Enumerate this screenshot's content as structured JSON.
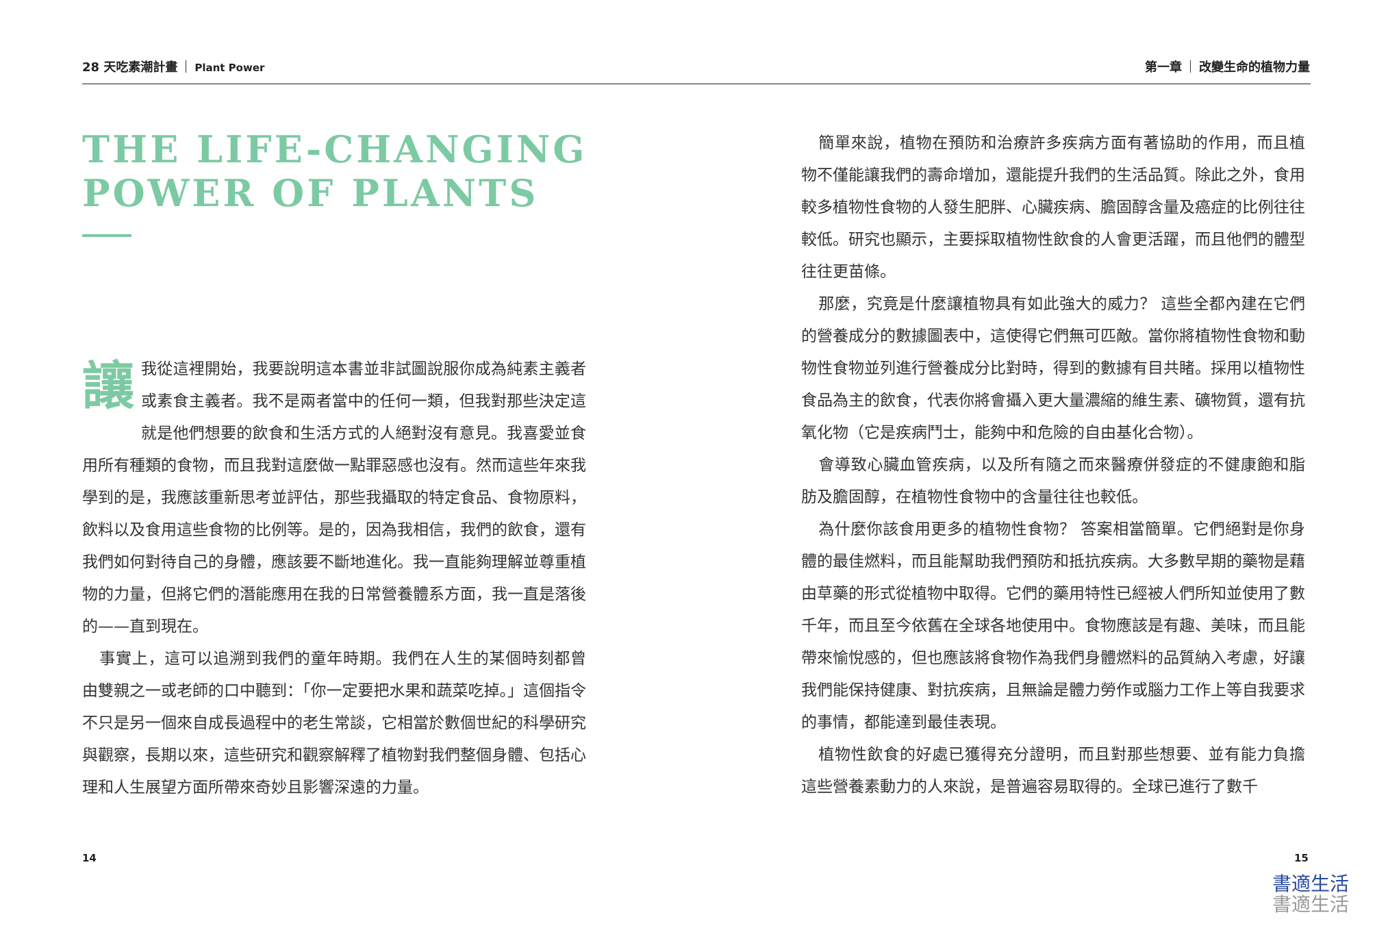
{
  "header": {
    "left_title": "28 天吃素潮計畫",
    "left_subtitle": "Plant Power",
    "right_chapter": "第一章",
    "right_title": "改變生命的植物力量"
  },
  "title": {
    "line1": "THE LIFE-CHANGING",
    "line2": "POWER OF PLANTS"
  },
  "left_column": {
    "dropcap": "讓",
    "p1": "我從這裡開始，我要說明這本書並非試圖說服你成為純素主義者或素食主義者。我不是兩者當中的任何一類，但我對那些決定這就是他們想要的飲食和生活方式的人絕對沒有意見。我喜愛並食用所有種類的食物，而且我對這麼做一點罪惡感也沒有。然而這些年來我學到的是，我應該重新思考並評估，那些我攝取的特定食品、食物原料，飲料以及食用這些食物的比例等。是的，因為我相信，我們的飲食，還有我們如何對待自己的身體，應該要不斷地進化。我一直能夠理解並尊重植物的力量，但將它們的潛能應用在我的日常營養體系方面，我一直是落後的——直到現在。",
    "p2": "事實上，這可以追溯到我們的童年時期。我們在人生的某個時刻都曾由雙親之一或老師的口中聽到：「你一定要把水果和蔬菜吃掉。」這個指令不只是另一個來自成長過程中的老生常談，它相當於數個世紀的科學研究與觀察，長期以來，這些研究和觀察解釋了植物對我們整個身體、包括心理和人生展望方面所帶來奇妙且影響深遠的力量。"
  },
  "right_column": {
    "p1": "簡單來說，植物在預防和治療許多疾病方面有著協助的作用，而且植物不僅能讓我們的壽命增加，還能提升我們的生活品質。除此之外，食用較多植物性食物的人發生肥胖、心臟疾病、膽固醇含量及癌症的比例往往較低。研究也顯示，主要採取植物性飲食的人會更活躍，而且他們的體型往往更苗條。",
    "p2": "那麼，究竟是什麼讓植物具有如此強大的威力？ 這些全都內建在它們的營養成分的數據圖表中，這使得它們無可匹敵。當你將植物性食物和動物性食物並列進行營養成分比對時，得到的數據有目共睹。採用以植物性食品為主的飲食，代表你將會攝入更大量濃縮的維生素、礦物質，還有抗氧化物（它是疾病鬥士，能夠中和危險的自由基化合物）。",
    "p3": "會導致心臟血管疾病，以及所有隨之而來醫療併發症的不健康飽和脂肪及膽固醇，在植物性食物中的含量往往也較低。",
    "p4": "為什麼你該食用更多的植物性食物？ 答案相當簡單。它們絕對是你身體的最佳燃料，而且能幫助我們預防和抵抗疾病。大多數早期的藥物是藉由草藥的形式從植物中取得。它們的藥用特性已經被人們所知並使用了數千年，而且至今依舊在全球各地使用中。食物應該是有趣、美味，而且能帶來愉悅感的，但也應該將食物作為我們身體燃料的品質納入考慮，好讓我們能保持健康、對抗疾病，且無論是體力勞作或腦力工作上等自我要求的事情，都能達到最佳表現。",
    "p5": "植物性飲食的好處已獲得充分證明，而且對那些想要、並有能力負擔這些營養素動力的人來說，是普遍容易取得的。全球已進行了數千"
  },
  "footer": {
    "page_left": "14",
    "page_right": "15"
  },
  "watermark": {
    "line1": "書適生活",
    "line2": "書適生活"
  },
  "colors": {
    "accent": "#7ccaa3",
    "text": "#333333",
    "watermark_blue": "#2a4aa0"
  }
}
